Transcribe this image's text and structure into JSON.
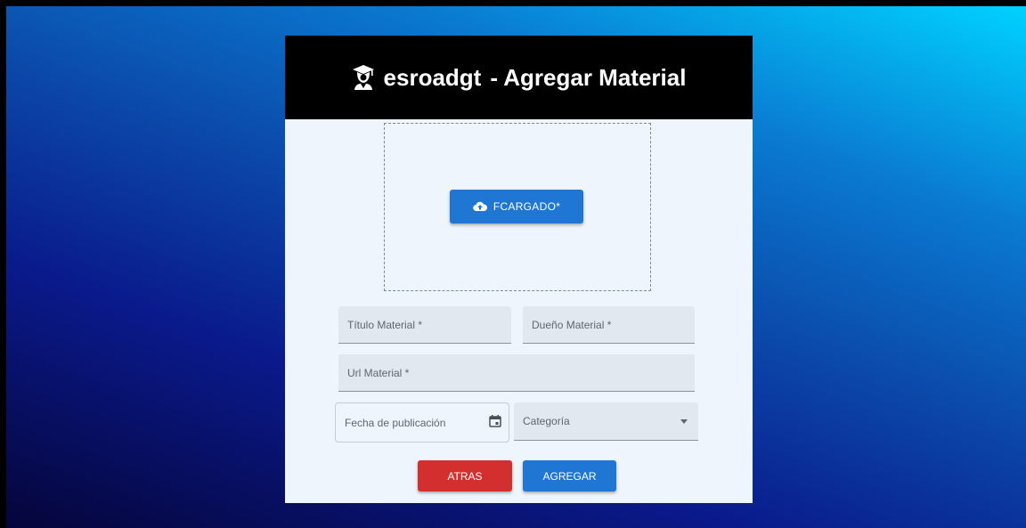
{
  "header": {
    "brand": "esroadgt",
    "title": "- Agregar Material",
    "logo_icon": "graduation-cap-icon"
  },
  "upload": {
    "button_label": "FCARGADO*",
    "icon": "cloud-upload-icon"
  },
  "form": {
    "titulo_label": "Título Material *",
    "dueno_label": "Dueño Material *",
    "url_label": "Url Material *",
    "fecha_label": "Fecha de publicación",
    "fecha_icon": "calendar-icon",
    "categoria_label": "Categoría",
    "categoria_icon": "caret-down-icon"
  },
  "actions": {
    "back_label": "ATRAS",
    "submit_label": "AGREGAR"
  },
  "colors": {
    "primary": "#1f77d3",
    "danger": "#d32f2f",
    "header_bg": "#000000",
    "card_bg": "#eef5fc"
  }
}
